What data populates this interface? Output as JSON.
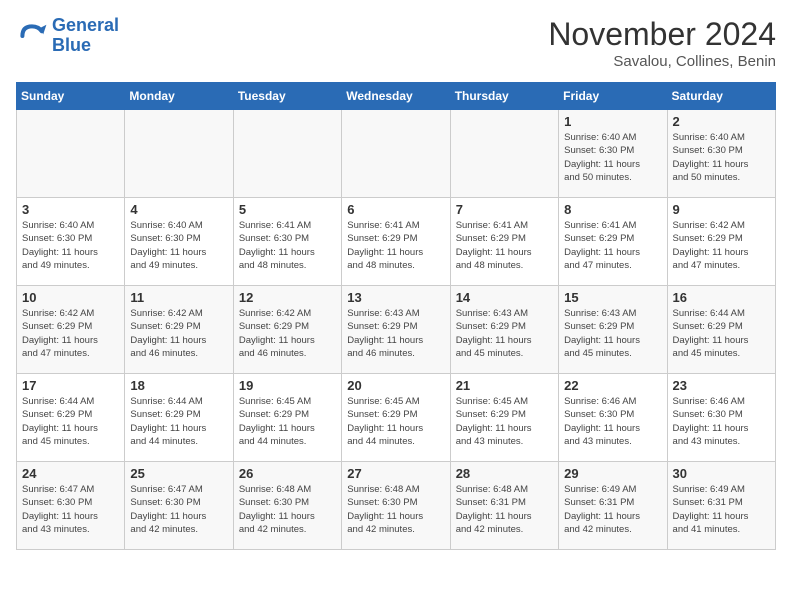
{
  "logo": {
    "line1": "General",
    "line2": "Blue"
  },
  "title": "November 2024",
  "location": "Savalou, Collines, Benin",
  "days_of_week": [
    "Sunday",
    "Monday",
    "Tuesday",
    "Wednesday",
    "Thursday",
    "Friday",
    "Saturday"
  ],
  "weeks": [
    [
      {
        "day": "",
        "info": ""
      },
      {
        "day": "",
        "info": ""
      },
      {
        "day": "",
        "info": ""
      },
      {
        "day": "",
        "info": ""
      },
      {
        "day": "",
        "info": ""
      },
      {
        "day": "1",
        "info": "Sunrise: 6:40 AM\nSunset: 6:30 PM\nDaylight: 11 hours\nand 50 minutes."
      },
      {
        "day": "2",
        "info": "Sunrise: 6:40 AM\nSunset: 6:30 PM\nDaylight: 11 hours\nand 50 minutes."
      }
    ],
    [
      {
        "day": "3",
        "info": "Sunrise: 6:40 AM\nSunset: 6:30 PM\nDaylight: 11 hours\nand 49 minutes."
      },
      {
        "day": "4",
        "info": "Sunrise: 6:40 AM\nSunset: 6:30 PM\nDaylight: 11 hours\nand 49 minutes."
      },
      {
        "day": "5",
        "info": "Sunrise: 6:41 AM\nSunset: 6:30 PM\nDaylight: 11 hours\nand 48 minutes."
      },
      {
        "day": "6",
        "info": "Sunrise: 6:41 AM\nSunset: 6:29 PM\nDaylight: 11 hours\nand 48 minutes."
      },
      {
        "day": "7",
        "info": "Sunrise: 6:41 AM\nSunset: 6:29 PM\nDaylight: 11 hours\nand 48 minutes."
      },
      {
        "day": "8",
        "info": "Sunrise: 6:41 AM\nSunset: 6:29 PM\nDaylight: 11 hours\nand 47 minutes."
      },
      {
        "day": "9",
        "info": "Sunrise: 6:42 AM\nSunset: 6:29 PM\nDaylight: 11 hours\nand 47 minutes."
      }
    ],
    [
      {
        "day": "10",
        "info": "Sunrise: 6:42 AM\nSunset: 6:29 PM\nDaylight: 11 hours\nand 47 minutes."
      },
      {
        "day": "11",
        "info": "Sunrise: 6:42 AM\nSunset: 6:29 PM\nDaylight: 11 hours\nand 46 minutes."
      },
      {
        "day": "12",
        "info": "Sunrise: 6:42 AM\nSunset: 6:29 PM\nDaylight: 11 hours\nand 46 minutes."
      },
      {
        "day": "13",
        "info": "Sunrise: 6:43 AM\nSunset: 6:29 PM\nDaylight: 11 hours\nand 46 minutes."
      },
      {
        "day": "14",
        "info": "Sunrise: 6:43 AM\nSunset: 6:29 PM\nDaylight: 11 hours\nand 45 minutes."
      },
      {
        "day": "15",
        "info": "Sunrise: 6:43 AM\nSunset: 6:29 PM\nDaylight: 11 hours\nand 45 minutes."
      },
      {
        "day": "16",
        "info": "Sunrise: 6:44 AM\nSunset: 6:29 PM\nDaylight: 11 hours\nand 45 minutes."
      }
    ],
    [
      {
        "day": "17",
        "info": "Sunrise: 6:44 AM\nSunset: 6:29 PM\nDaylight: 11 hours\nand 45 minutes."
      },
      {
        "day": "18",
        "info": "Sunrise: 6:44 AM\nSunset: 6:29 PM\nDaylight: 11 hours\nand 44 minutes."
      },
      {
        "day": "19",
        "info": "Sunrise: 6:45 AM\nSunset: 6:29 PM\nDaylight: 11 hours\nand 44 minutes."
      },
      {
        "day": "20",
        "info": "Sunrise: 6:45 AM\nSunset: 6:29 PM\nDaylight: 11 hours\nand 44 minutes."
      },
      {
        "day": "21",
        "info": "Sunrise: 6:45 AM\nSunset: 6:29 PM\nDaylight: 11 hours\nand 43 minutes."
      },
      {
        "day": "22",
        "info": "Sunrise: 6:46 AM\nSunset: 6:30 PM\nDaylight: 11 hours\nand 43 minutes."
      },
      {
        "day": "23",
        "info": "Sunrise: 6:46 AM\nSunset: 6:30 PM\nDaylight: 11 hours\nand 43 minutes."
      }
    ],
    [
      {
        "day": "24",
        "info": "Sunrise: 6:47 AM\nSunset: 6:30 PM\nDaylight: 11 hours\nand 43 minutes."
      },
      {
        "day": "25",
        "info": "Sunrise: 6:47 AM\nSunset: 6:30 PM\nDaylight: 11 hours\nand 42 minutes."
      },
      {
        "day": "26",
        "info": "Sunrise: 6:48 AM\nSunset: 6:30 PM\nDaylight: 11 hours\nand 42 minutes."
      },
      {
        "day": "27",
        "info": "Sunrise: 6:48 AM\nSunset: 6:30 PM\nDaylight: 11 hours\nand 42 minutes."
      },
      {
        "day": "28",
        "info": "Sunrise: 6:48 AM\nSunset: 6:31 PM\nDaylight: 11 hours\nand 42 minutes."
      },
      {
        "day": "29",
        "info": "Sunrise: 6:49 AM\nSunset: 6:31 PM\nDaylight: 11 hours\nand 42 minutes."
      },
      {
        "day": "30",
        "info": "Sunrise: 6:49 AM\nSunset: 6:31 PM\nDaylight: 11 hours\nand 41 minutes."
      }
    ]
  ]
}
